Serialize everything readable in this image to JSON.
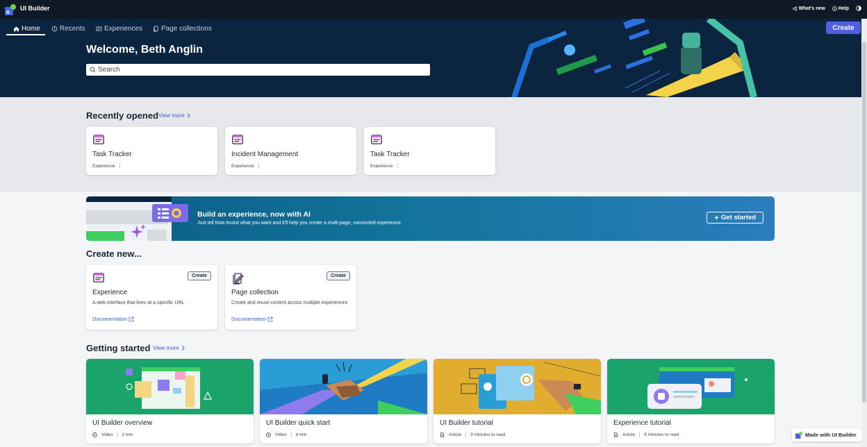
{
  "app": {
    "title": "UI Builder"
  },
  "topbar": {
    "whats_new": "What's new",
    "help": "Help"
  },
  "nav": {
    "tabs": [
      {
        "label": "Home",
        "active": true
      },
      {
        "label": "Recents"
      },
      {
        "label": "Experiences"
      },
      {
        "label": "Page collections"
      }
    ],
    "create_label": "Create"
  },
  "hero": {
    "welcome": "Welcome, Beth Anglin",
    "search_placeholder": "Search"
  },
  "recent": {
    "heading": "Recently opened",
    "view_more": "View more",
    "items": [
      {
        "title": "Task Tracker",
        "type": "Experience"
      },
      {
        "title": "Incident Management",
        "type": "Experience"
      },
      {
        "title": "Task Tracker",
        "type": "Experience"
      }
    ]
  },
  "banner": {
    "title": "Build an experience, now with AI",
    "subtitle": "Just tell Now Assist what you want and it'll help you create a multi-page, connected experience.",
    "button": "Get started"
  },
  "create_new": {
    "heading": "Create new...",
    "cards": [
      {
        "title": "Experience",
        "desc": "A web interface that lives at a specific URL",
        "button": "Create",
        "doc": "Documentation"
      },
      {
        "title": "Page collection",
        "desc": "Create and reuse content across multiple experiences",
        "button": "Create",
        "doc": "Documentation"
      }
    ]
  },
  "getting_started": {
    "heading": "Getting started",
    "view_more": "View more",
    "items": [
      {
        "title": "UI Builder overview",
        "kind": "Video",
        "duration": "2 min"
      },
      {
        "title": "UI Builder quick start",
        "kind": "Video",
        "duration": "4 min"
      },
      {
        "title": "UI Builder tutorial",
        "kind": "Article",
        "duration": "9 minutes to read"
      },
      {
        "title": "Experience tutorial",
        "kind": "Article",
        "duration": "9 minutes to read"
      }
    ]
  },
  "footer": {
    "made_with": "Made with UI Builder"
  },
  "colors": {
    "accent": "#4e5fe0",
    "hero_bg": "#0b2540",
    "link": "#3a5bcf"
  }
}
